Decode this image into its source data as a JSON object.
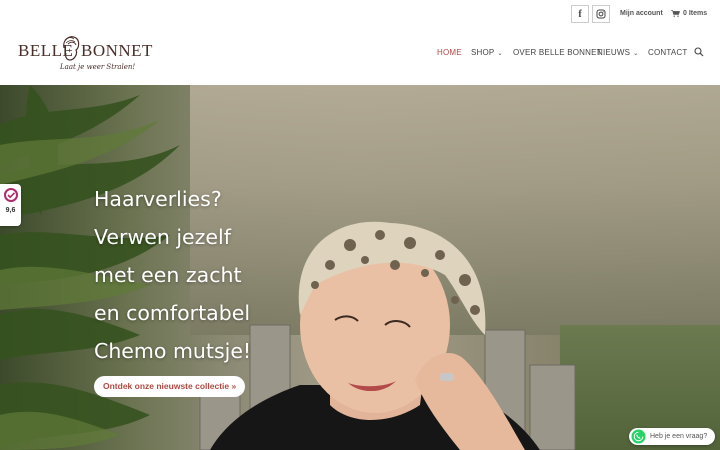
{
  "topbar": {
    "social": [
      {
        "name": "facebook",
        "icon": "facebook-icon",
        "glyph": "f"
      },
      {
        "name": "instagram",
        "icon": "instagram-icon"
      }
    ],
    "account_label": "Mijn account",
    "cart_label": "0 Items",
    "cart_icon": "cart-icon"
  },
  "logo": {
    "word1": "BELLE",
    "word2": "BONNET",
    "tagline": "Laat je weer Stralen!"
  },
  "nav": {
    "items": [
      {
        "label": "HOME",
        "active": true
      },
      {
        "label": "SHOP",
        "dropdown": true
      },
      {
        "label": "OVER BELLE BONNET"
      },
      {
        "label": "NIEUWS",
        "dropdown": true
      },
      {
        "label": "CONTACT"
      }
    ],
    "search_icon": "search-icon"
  },
  "hero": {
    "lines": [
      "Haarverlies?",
      "Verwen jezelf",
      "met een zacht",
      "en comfortabel",
      "Chemo mutsje!"
    ],
    "cta_label": "Ontdek onze nieuwste collectie »"
  },
  "rating": {
    "value": "9,6"
  },
  "whatsapp": {
    "label": "Heb je een vraag?"
  },
  "colors": {
    "accent": "#b24a43",
    "brand_text": "#4a2e2a",
    "whatsapp": "#25d366"
  }
}
